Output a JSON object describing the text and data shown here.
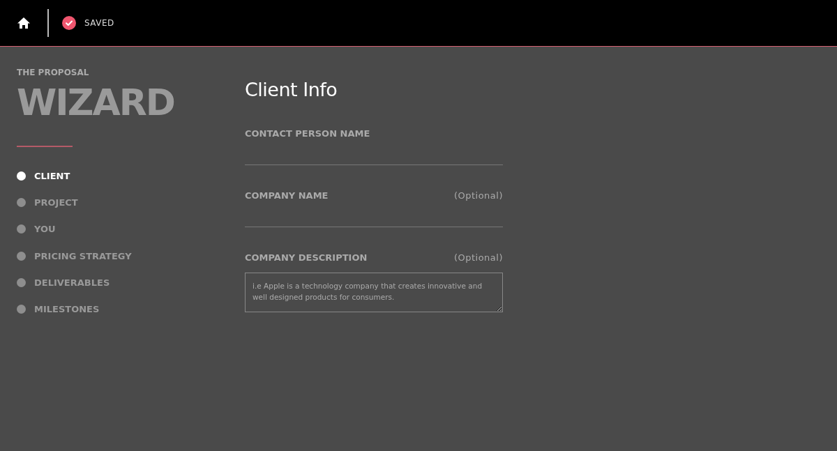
{
  "top_bar": {
    "status": {
      "saved": true,
      "label": "SAVED"
    }
  },
  "sidebar": {
    "subtitle": "THE PROPOSAL",
    "title": "WIZARD",
    "steps": [
      {
        "label": "CLIENT",
        "selected": true
      },
      {
        "label": "PROJECT",
        "selected": false
      },
      {
        "label": "YOU",
        "selected": false
      },
      {
        "label": "PRICING STRATEGY",
        "selected": false
      },
      {
        "label": "DELIVERABLES",
        "selected": false
      },
      {
        "label": "MILESTONES",
        "selected": false
      }
    ]
  },
  "form": {
    "title": "Client Info",
    "fields": [
      {
        "kind": "line",
        "label": "CONTACT PERSON NAME"
      },
      {
        "kind": "line",
        "label": "COMPANY NAME",
        "note": "(Optional)"
      },
      {
        "kind": "textarea",
        "label": "COMPANY DESCRIPTION",
        "note": "(Optional)",
        "placeholder": "i.e Apple is a technology company that creates innovative and well designed products for consumers."
      }
    ]
  }
}
